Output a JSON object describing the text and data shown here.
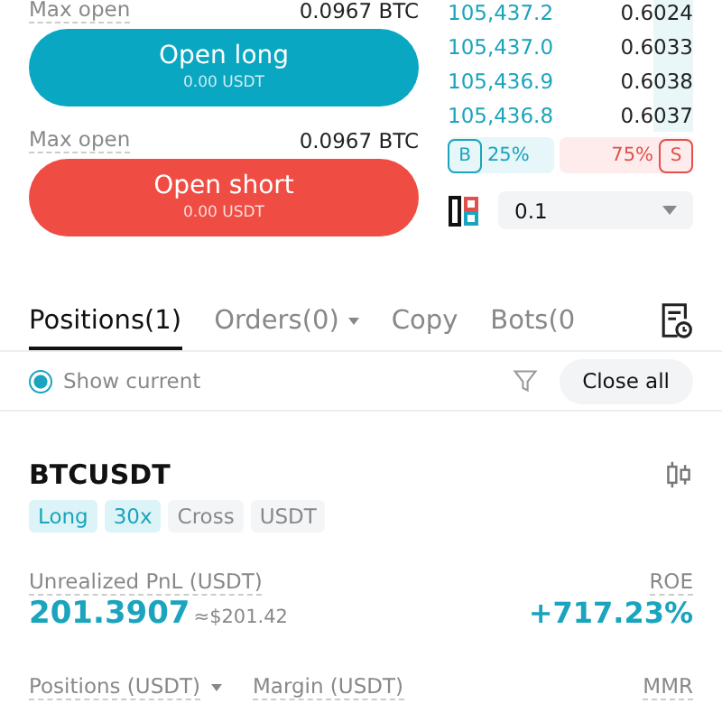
{
  "order_form": {
    "long": {
      "max_label": "Max open",
      "max_value": "0.0967 BTC",
      "button": "Open long",
      "amount": "0.00 USDT"
    },
    "short": {
      "max_label": "Max open",
      "max_value": "0.0967 BTC",
      "button": "Open short",
      "amount": "0.00 USDT"
    }
  },
  "order_book": {
    "rows": [
      {
        "price": "105,437.2",
        "qty": "0.6024"
      },
      {
        "price": "105,437.0",
        "qty": "0.6033"
      },
      {
        "price": "105,436.9",
        "qty": "0.6038"
      },
      {
        "price": "105,436.8",
        "qty": "0.6037"
      }
    ],
    "buy_tag": "B",
    "buy_ratio": "25%",
    "sell_ratio": "75%",
    "sell_tag": "S",
    "precision": "0.1"
  },
  "tabs": [
    {
      "label": "Positions(1)",
      "selected": true,
      "dropdown": false
    },
    {
      "label": "Orders(0)",
      "selected": false,
      "dropdown": true
    },
    {
      "label": "Copy",
      "selected": false,
      "dropdown": false
    },
    {
      "label": "Bots(0",
      "selected": false,
      "dropdown": false
    }
  ],
  "filter": {
    "show_current": "Show current",
    "checked": true,
    "close_all": "Close all"
  },
  "position": {
    "symbol": "BTCUSDT",
    "tags": [
      {
        "label": "Long",
        "kind": "accent"
      },
      {
        "label": "30x",
        "kind": "accent"
      },
      {
        "label": "Cross",
        "kind": "plain"
      },
      {
        "label": "USDT",
        "kind": "plain"
      }
    ],
    "pnl_label": "Unrealized PnL (USDT)",
    "pnl": "201.3907",
    "pnl_usd": "≈$201.42",
    "roe_label": "ROE",
    "roe": "+717.23%",
    "stats": [
      {
        "label": "Positions (USDT)",
        "dropdown": true
      },
      {
        "label": "Margin (USDT)",
        "dropdown": false
      },
      {
        "label": "MMR",
        "dropdown": false
      }
    ]
  }
}
